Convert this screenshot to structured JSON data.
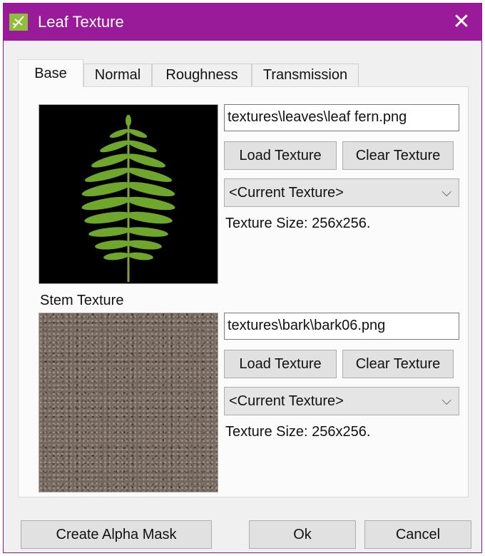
{
  "window": {
    "title": "Leaf Texture",
    "close_icon": "close-icon",
    "app_icon": "leaf-app-icon",
    "accent": "#991b99"
  },
  "tabs": [
    {
      "label": "Base",
      "active": true
    },
    {
      "label": "Normal",
      "active": false
    },
    {
      "label": "Roughness",
      "active": false
    },
    {
      "label": "Transmission",
      "active": false
    }
  ],
  "leaf": {
    "path": "textures\\leaves\\leaf fern.png",
    "load_label": "Load Texture",
    "clear_label": "Clear Texture",
    "combo_value": "<Current Texture>",
    "size_text": "Texture Size: 256x256."
  },
  "stem": {
    "label": "Stem Texture",
    "path": "textures\\bark\\bark06.png",
    "load_label": "Load Texture",
    "clear_label": "Clear Texture",
    "combo_value": "<Current Texture>",
    "size_text": "Texture Size: 256x256."
  },
  "footer": {
    "alpha_label": "Create Alpha Mask",
    "ok_label": "Ok",
    "cancel_label": "Cancel"
  }
}
